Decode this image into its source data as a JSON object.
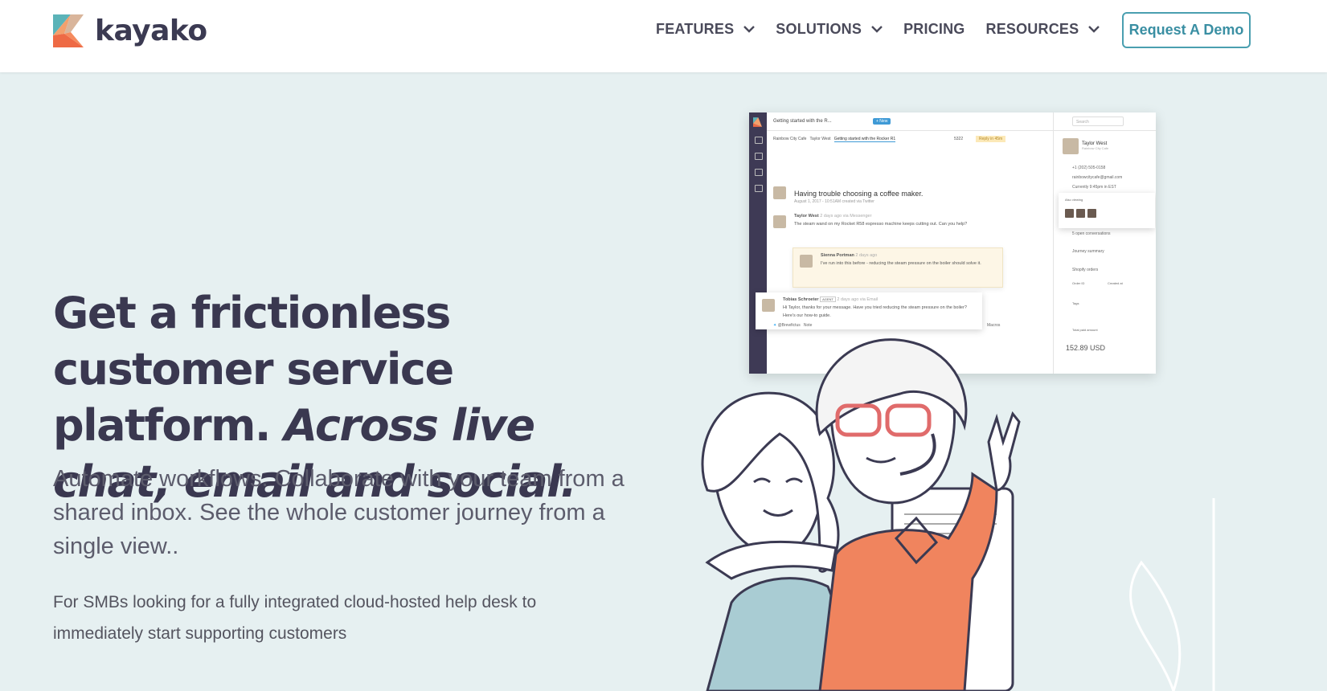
{
  "brand": {
    "name": "kayako"
  },
  "nav": {
    "items": [
      {
        "label": "FEATURES",
        "dropdown": true
      },
      {
        "label": "SOLUTIONS",
        "dropdown": true
      },
      {
        "label": "PRICING",
        "dropdown": false
      },
      {
        "label": "RESOURCES",
        "dropdown": true
      }
    ],
    "cta": "Request A Demo"
  },
  "hero": {
    "title_plain": "Get a frictionless customer service platform.",
    "title_italic": "Across live chat, email and social.",
    "subtitle": "Automate workflows. Collaborate with your team from a shared inbox. See the whole customer journey from a single view..",
    "note": "For SMBs looking for a fully integrated cloud-hosted help desk to immediately start supporting customers"
  },
  "app_preview": {
    "tab_title": "Getting started with the R...",
    "new_button": "+ New",
    "search_placeholder": "Search",
    "breadcrumbs": [
      "Rainbow City Cafe",
      "Taylor West",
      "Getting started with the Rocker R1"
    ],
    "ticket_number": "5322",
    "reply_status": "Reply in 45m",
    "conversation_title": "Having trouble choosing a coffee maker.",
    "conversation_meta": "August 1, 2017 - 10:51AM created via Twitter",
    "messages": [
      {
        "author": "Taylor West",
        "meta": "2 days ago via Messenger",
        "text": "The steam wand on my Rocket R58 espresso machine keeps cutting out. Can you help?"
      },
      {
        "author": "Sienna Portman",
        "meta": "2 days ago",
        "text": "I've run into this before - reducing the steam pressure on the boiler should solve it."
      },
      {
        "author": "Tobias Schroeter",
        "meta": "2 days ago via Email",
        "badge": "AGENT",
        "text": "Hi Taylor, thanks for your message. Have you tried reducing the steam pressure on the boiler? Here's our how-to guide."
      }
    ],
    "reply_handle": "@Brewfictus",
    "reply_mode": "Note",
    "macros": "Macros",
    "customer": {
      "name": "Taylor West",
      "company": "Rainbow City Cafe",
      "phone": "+1 (202) 505-0158",
      "email": "rainbowcitycafe@gmail.com",
      "time": "Currently 9:45pm in EST",
      "also_viewing": "Also viewing",
      "open_conversations": "5 open conversations",
      "journey": "Journey summary",
      "shopify": "Shopify orders",
      "order_id_label": "Order ID",
      "created_label": "Created at",
      "tags_label": "Tags",
      "total_label": "Total paid amount",
      "total_value": "152.89 USD"
    }
  },
  "colors": {
    "background": "#e6f0f1",
    "accent": "#3a8fa3",
    "brand_orange": "#f0845e",
    "brand_teal": "#5bb3b8",
    "title": "#3a3850"
  }
}
